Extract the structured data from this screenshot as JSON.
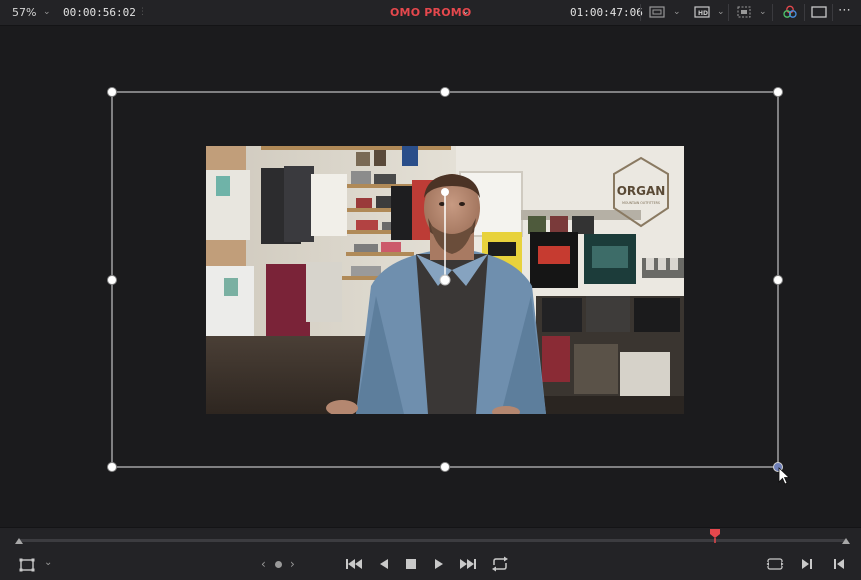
{
  "topbar": {
    "zoom": "57%",
    "timecode_left": "00:00:56:02",
    "timeline_title": "OMO PROMO",
    "timecode_right": "01:00:47:06"
  },
  "viewer": {
    "video": {
      "logo_text": "ORGAN",
      "logo_subtext": "MOUNTAIN OUTFITTERS"
    }
  },
  "colors": {
    "title": "#e5484d",
    "playhead": "#e5484d",
    "transform_box": "#ffffff",
    "background": "#1b1b1d"
  },
  "icons": {
    "toolbar": [
      "viewer-size-icon",
      "hd-output-icon",
      "onscreen-controls-icon",
      "color-wheel-icon",
      "single-viewer-icon",
      "more-options-icon"
    ],
    "transport": [
      "jump-to-start-icon",
      "reverse-play-icon",
      "stop-icon",
      "play-icon",
      "jump-to-end-icon",
      "loop-icon"
    ]
  }
}
